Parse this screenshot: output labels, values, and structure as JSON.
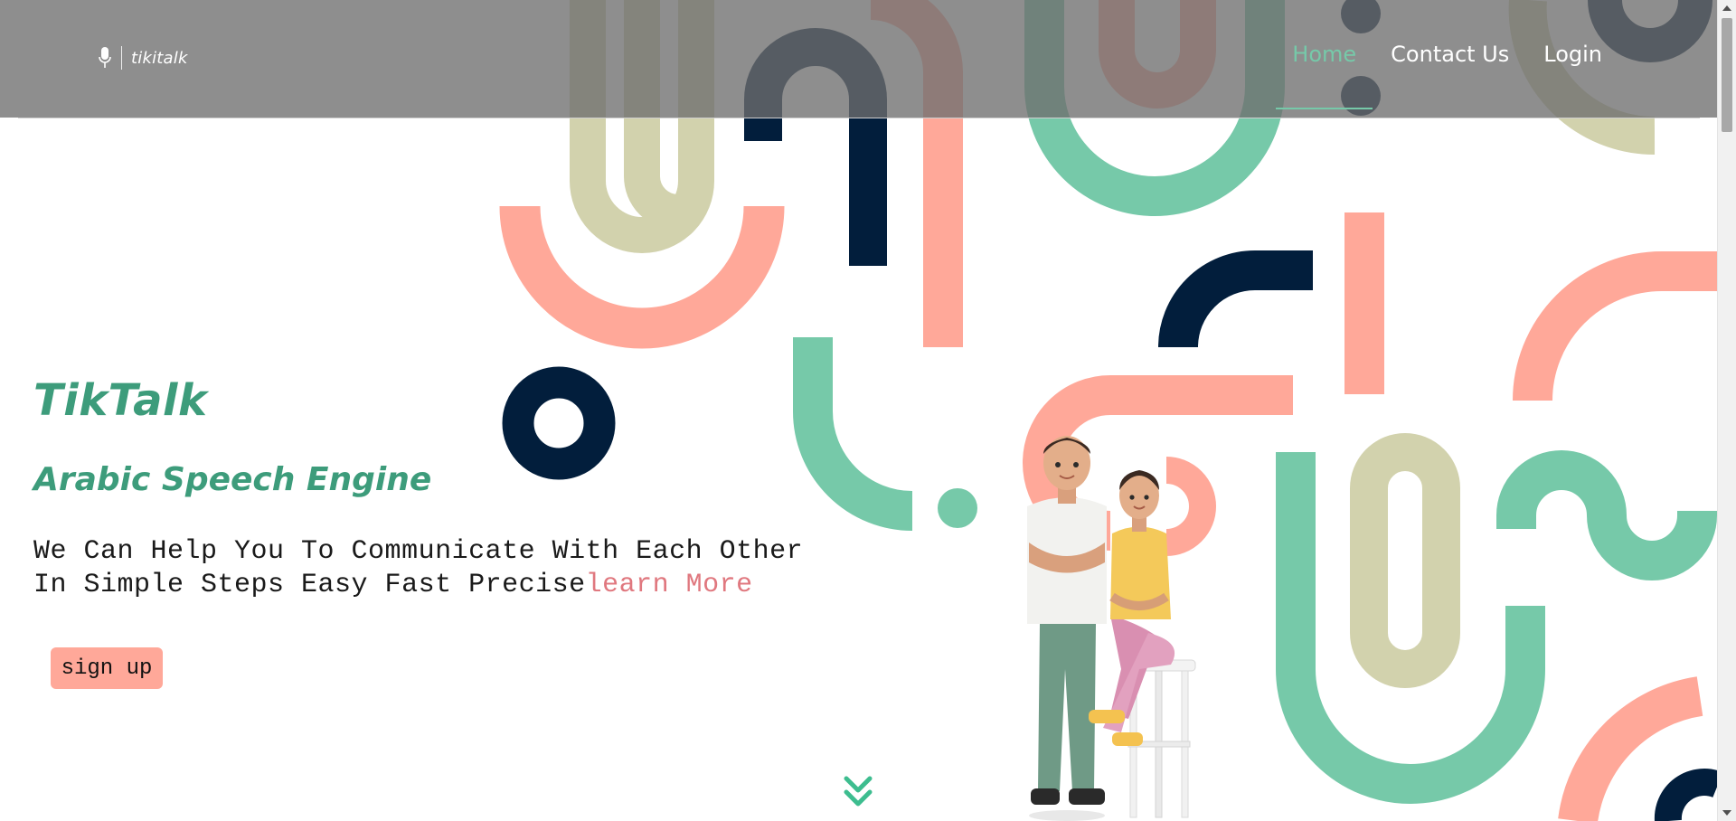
{
  "header": {
    "brand_name": "tikitalk",
    "nav": [
      {
        "label": "Home",
        "active": true
      },
      {
        "label": "Contact Us",
        "active": false
      },
      {
        "label": "Login",
        "active": false
      }
    ]
  },
  "hero": {
    "title": "TikTalk",
    "subtitle": "Arabic Speech Engine",
    "description_line1": "We Can Help You To Communicate With Each Other",
    "description_line2": "In Simple Steps Easy Fast Precise",
    "learn_more": "learn More",
    "signup_label": "sign up"
  },
  "icons": {
    "brand": "microphone-icon",
    "scroll_down": "double-chevron-down-icon"
  },
  "colors": {
    "accent_green": "#76c9a9",
    "title_green": "#3d9c7b",
    "salmon": "#ffa899",
    "navy": "#021e3c",
    "sage": "#d2d2ad",
    "link_red": "#e0787f",
    "header_overlay": "#6e6e6e"
  }
}
